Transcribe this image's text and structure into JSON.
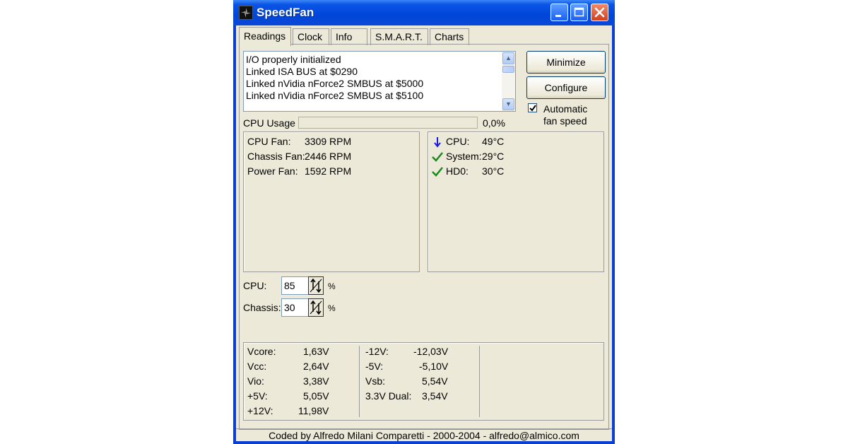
{
  "window": {
    "title": "SpeedFan",
    "colors": {
      "titlebar": "#0a55e6",
      "client": "#ece9d8",
      "close": "#d2401e",
      "ok": "#1a8a1a",
      "down": "#1a1ae6"
    }
  },
  "tabs": [
    "Readings",
    "Clock",
    "Info",
    "S.M.A.R.T.",
    "Charts"
  ],
  "log": {
    "lines": [
      "I/O properly initialized",
      "Linked ISA BUS at $0290",
      "Linked nVidia nForce2 SMBUS at $5000",
      "Linked nVidia nForce2 SMBUS at $5100"
    ]
  },
  "buttons": {
    "minimize": "Minimize",
    "configure": "Configure"
  },
  "auto_fan": {
    "label_line1": "Automatic",
    "label_line2": "fan speed",
    "checked": true
  },
  "cpu_usage": {
    "label": "CPU Usage",
    "value": "0,0%",
    "fraction": 0.0
  },
  "fans": [
    {
      "label": "CPU Fan:",
      "value": "3309 RPM"
    },
    {
      "label": "Chassis Fan:",
      "value": "2446 RPM"
    },
    {
      "label": "Power Fan:",
      "value": "1592 RPM"
    }
  ],
  "temps": [
    {
      "label": "CPU:",
      "value": "49°C",
      "status_icon": "arrow-down-icon"
    },
    {
      "label": "System:",
      "value": "29°C",
      "status_icon": "checkmark-icon"
    },
    {
      "label": "HD0:",
      "value": "30°C",
      "status_icon": "checkmark-icon"
    }
  ],
  "speeds": [
    {
      "label": "CPU:",
      "value": "85",
      "unit": "%"
    },
    {
      "label": "Chassis:",
      "value": "30",
      "unit": "%"
    }
  ],
  "voltages_left": [
    {
      "label": "Vcore:",
      "value": "1,63V"
    },
    {
      "label": "Vcc:",
      "value": "2,64V"
    },
    {
      "label": "Vio:",
      "value": "3,38V"
    },
    {
      "label": "+5V:",
      "value": "5,05V"
    },
    {
      "label": "+12V:",
      "value": "11,98V"
    }
  ],
  "voltages_right": [
    {
      "label": "-12V:",
      "value": "-12,03V"
    },
    {
      "label": "-5V:",
      "value": "-5,10V"
    },
    {
      "label": "Vsb:",
      "value": "5,54V"
    },
    {
      "label": "3.3V Dual:",
      "value": "3,54V"
    }
  ],
  "status": "Coded by Alfredo Milani Comparetti - 2000-2004 - alfredo@almico.com"
}
